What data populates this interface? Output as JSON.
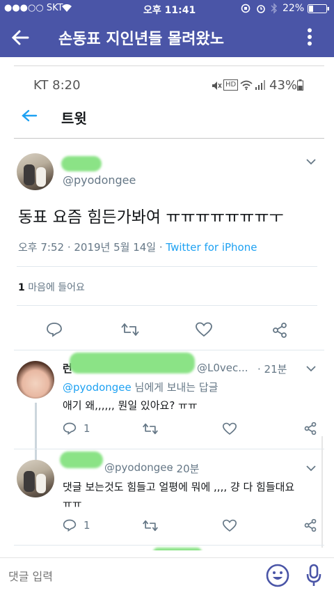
{
  "status_bar": {
    "carrier": "●●●○○ SKT",
    "time": "오후 11:41",
    "battery": "22%"
  },
  "app_bar": {
    "title": "손동표 지인년들 몰려왔노",
    "back_icon": "arrow-left-icon",
    "more_icon": "more-vert-icon"
  },
  "inner_status": {
    "carrier_time": "KT 8:20",
    "battery": "43%"
  },
  "tweet_header": {
    "title": "트윗"
  },
  "tweet": {
    "handle": "@pyodongee",
    "text": "동표 요즘 힘든가봐여 ㅠㅠㅠㅠㅠㅠㅠㅜ",
    "timestamp": "오후 7:52 · 2019년 5월 14일 · ",
    "source": "Twitter for iPhone",
    "likes_count": "1",
    "likes_label": " 마음에 들어요"
  },
  "replies": [
    {
      "name_prefix": "런",
      "handle": "@L0vec...",
      "time": "· 21분",
      "reply_to_handle": "@pyodongee",
      "reply_to_suffix": " 님에게 보내는 답글",
      "text": "애기 왜,,,,,, 뭔일 있아요? ㅠㅠ",
      "reply_count": "1"
    },
    {
      "handle": "@pyodongee",
      "time": "· 20분",
      "text_line1": "댓글 보는것도 힘들고 얼평에 뭐에 ,,,, 걍 다 힘들대요",
      "text_line2": "ㅠㅠ",
      "reply_count": "1"
    }
  ],
  "composer": {
    "placeholder": "댓글 입력"
  }
}
